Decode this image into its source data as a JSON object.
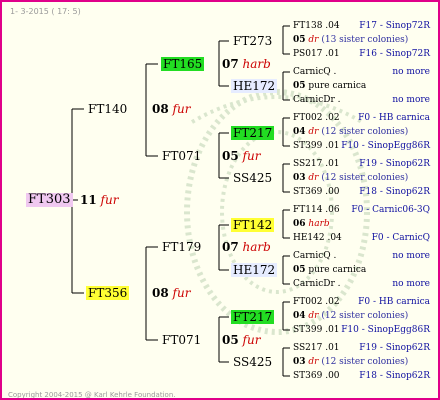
{
  "header": {
    "date": "1-  3-2015  ( 17:  5)"
  },
  "root": {
    "name": "FT303",
    "gen": "11",
    "tag": "fur"
  },
  "g1": [
    {
      "name": "FT140",
      "gen": "08",
      "tag": "fur"
    },
    {
      "name": "FT356",
      "gen": "08",
      "tag": "fur"
    }
  ],
  "g2": [
    {
      "name": "FT165",
      "gen": "07",
      "tag": "harb"
    },
    {
      "name": "FT071",
      "gen": "05",
      "tag": "fur"
    },
    {
      "name": "FT179",
      "gen": "07",
      "tag": "harb"
    },
    {
      "name": "FT071",
      "gen": "05",
      "tag": "fur"
    }
  ],
  "g3": [
    {
      "name": "FT273"
    },
    {
      "name": "HE172"
    },
    {
      "name": "FT217"
    },
    {
      "name": "SS425"
    },
    {
      "name": "FT142"
    },
    {
      "name": "HE172"
    },
    {
      "name": "FT217"
    },
    {
      "name": "SS425"
    }
  ],
  "g4": [
    {
      "top": "FT138 .04",
      "topR": "F17 - Sinop72R",
      "mid_gen": "05",
      "mid_tag": "dr",
      "mid_note": "(13 sister colonies)",
      "bot": "PS017 .01",
      "botR": "F16 - Sinop72R"
    },
    {
      "top": "CarnicQ .",
      "topR": "no more",
      "mid_gen": "05",
      "mid_tag": "",
      "mid_note": "pure carnica",
      "bot": "CarnicDr .",
      "botR": "no more"
    },
    {
      "top": "FT002 .02",
      "topR": "F0 - HB carnica",
      "mid_gen": "04",
      "mid_tag": "dr",
      "mid_note": "(12 sister colonies)",
      "bot": "ST399 .01",
      "botR": "F10 - SinopEgg86R"
    },
    {
      "top": "SS217 .01",
      "topR": "F19 - Sinop62R",
      "mid_gen": "03",
      "mid_tag": "dr",
      "mid_note": "(12 sister colonies)",
      "bot": "ST369 .00",
      "botR": "F18 - Sinop62R"
    },
    {
      "top": "FT114 .06",
      "topR": "F0 - Carnic06-3Q",
      "mid_gen": "06",
      "mid_tag": "harb",
      "mid_note": "",
      "bot": "HE142 .04",
      "botR": "F0 - CarnicQ"
    },
    {
      "top": "CarnicQ .",
      "topR": "no more",
      "mid_gen": "05",
      "mid_tag": "",
      "mid_note": "pure carnica",
      "bot": "CarnicDr .",
      "botR": "no more"
    },
    {
      "top": "FT002 .02",
      "topR": "F0 - HB carnica",
      "mid_gen": "04",
      "mid_tag": "dr",
      "mid_note": "(12 sister colonies)",
      "bot": "ST399 .01",
      "botR": "F10 - SinopEgg86R"
    },
    {
      "top": "SS217 .01",
      "topR": "F19 - Sinop62R",
      "mid_gen": "03",
      "mid_tag": "dr",
      "mid_note": "(12 sister colonies)",
      "bot": "ST369 .00",
      "botR": "F18 - Sinop62R"
    }
  ],
  "footer": "Copyright 2004-2015 @ Karl Kehrle Foundation."
}
